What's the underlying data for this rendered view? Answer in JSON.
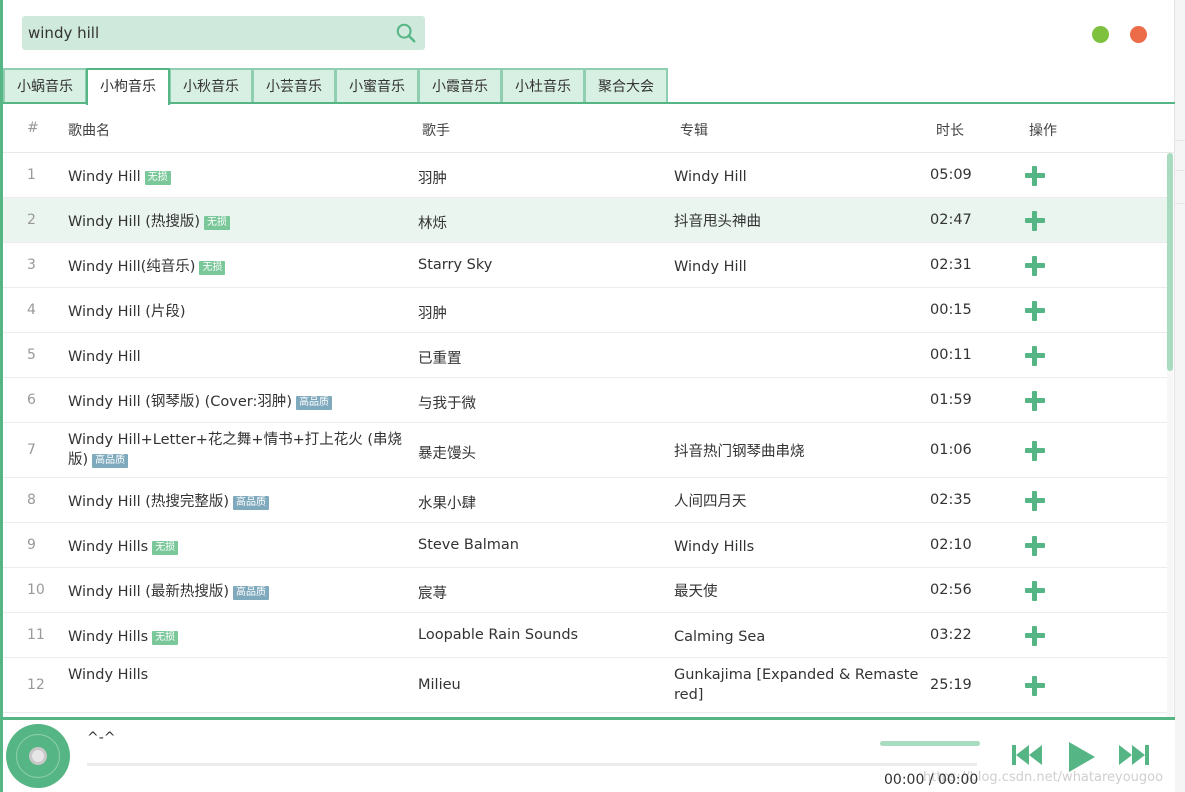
{
  "search": {
    "value": "windy hill",
    "placeholder": ""
  },
  "window_controls": [
    "minimize",
    "close"
  ],
  "colors": {
    "accent": "#55b584",
    "accent_light": "#cfe9dc",
    "lossless_badge": "#7ac79a",
    "hq_badge": "#7fa9bd",
    "min_dot": "#7ec13e",
    "close_dot": "#ec6b49"
  },
  "tabs": [
    {
      "label": "小蜗音乐",
      "active": false
    },
    {
      "label": "小枸音乐",
      "active": true
    },
    {
      "label": "小秋音乐",
      "active": false
    },
    {
      "label": "小芸音乐",
      "active": false
    },
    {
      "label": "小蜜音乐",
      "active": false
    },
    {
      "label": "小霞音乐",
      "active": false
    },
    {
      "label": "小杜音乐",
      "active": false
    },
    {
      "label": "聚合大会",
      "active": false
    }
  ],
  "table": {
    "headers": {
      "index": "#",
      "name": "歌曲名",
      "artist": "歌手",
      "album": "专辑",
      "duration": "时长",
      "action": "操作"
    },
    "rows": [
      {
        "index": "1",
        "name": "Windy Hill",
        "badge": "无损",
        "artist": "羽肿",
        "album": "Windy Hill",
        "duration": "05:09"
      },
      {
        "index": "2",
        "name": "Windy Hill (热搜版)",
        "badge": "无损",
        "artist": "林烁",
        "album": "抖音甩头神曲",
        "duration": "02:47",
        "highlight": true
      },
      {
        "index": "3",
        "name": "Windy Hill(纯音乐)",
        "badge": "无损",
        "artist": "Starry Sky",
        "album": "Windy Hill",
        "duration": "02:31"
      },
      {
        "index": "4",
        "name": "Windy Hill (片段)",
        "badge": "",
        "artist": "羽肿",
        "album": "",
        "duration": "00:15"
      },
      {
        "index": "5",
        "name": "Windy Hill",
        "badge": "",
        "artist": "已重置",
        "album": "",
        "duration": "00:11"
      },
      {
        "index": "6",
        "name": "Windy Hill (钢琴版) (Cover:羽肿)",
        "badge": "高品质",
        "artist": "与我于微",
        "album": "",
        "duration": "01:59"
      },
      {
        "index": "7",
        "name": "Windy Hill+Letter+花之舞+情书+打上花火 (串烧版)",
        "badge": "高品质",
        "artist": "暴走馒头",
        "album": "抖音热门钢琴曲串烧",
        "duration": "01:06"
      },
      {
        "index": "8",
        "name": "Windy Hill (热搜完整版)",
        "badge": "高品质",
        "artist": "水果小肆",
        "album": "人间四月天",
        "duration": "02:35"
      },
      {
        "index": "9",
        "name": "Windy Hills",
        "badge": "无损",
        "artist": "Steve Balman",
        "album": "Windy Hills",
        "duration": "02:10"
      },
      {
        "index": "10",
        "name": "Windy Hill (最新热搜版)",
        "badge": "高品质",
        "artist": "宸荨",
        "album": "最天使",
        "duration": "02:56"
      },
      {
        "index": "11",
        "name": "Windy Hills",
        "badge": "无损",
        "artist": "Loopable Rain Sounds",
        "album": "Calming Sea",
        "duration": "03:22"
      },
      {
        "index": "12",
        "name": "Windy Hills",
        "badge": "",
        "artist": "Milieu",
        "album": "Gunkajima [Expanded & Remastered]",
        "duration": "25:19"
      }
    ]
  },
  "player": {
    "title": "^-^",
    "time": "00:00 / 00:00",
    "progress": 0,
    "volume": 1.0,
    "watermark": "https://blog.csdn.net/whatareyougoo"
  }
}
